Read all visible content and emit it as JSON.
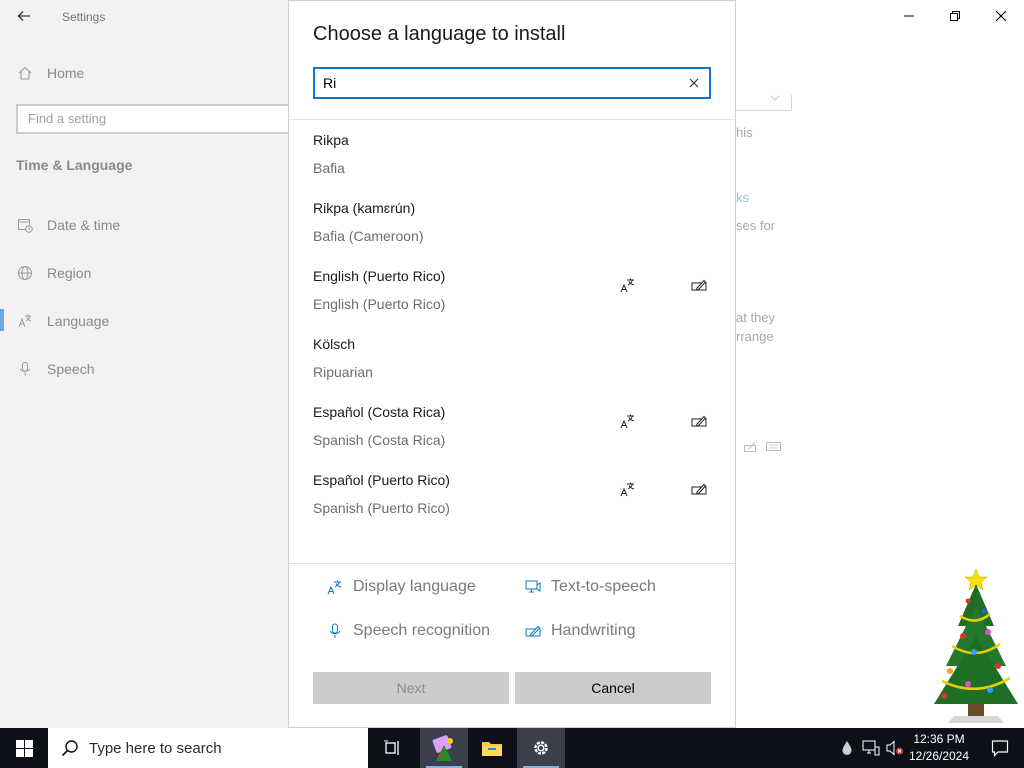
{
  "window": {
    "title": "Settings",
    "controls": {
      "minimize": "minimize-icon",
      "maximize": "restore-icon",
      "close": "close-icon"
    }
  },
  "nav": {
    "home": "Home",
    "find_placeholder": "Find a setting",
    "section": "Time & Language",
    "items": [
      {
        "label": "Date & time",
        "icon": "calendar-clock-icon"
      },
      {
        "label": "Region",
        "icon": "globe-icon"
      },
      {
        "label": "Language",
        "icon": "language-icon",
        "selected": true
      },
      {
        "label": "Speech",
        "icon": "microphone-icon"
      }
    ]
  },
  "background_peek": [
    "his",
    "ks",
    "ses for",
    "at they",
    "rrange"
  ],
  "dialog": {
    "title": "Choose a language to install",
    "search_value": "Ri",
    "languages": [
      {
        "native": "Rikpa",
        "english": "Bafia",
        "display_language": false,
        "handwriting": false
      },
      {
        "native": "Rikpa (kamɛrún)",
        "english": "Bafia (Cameroon)",
        "display_language": false,
        "handwriting": false
      },
      {
        "native": "English (Puerto Rico)",
        "english": "English (Puerto Rico)",
        "display_language": true,
        "handwriting": true
      },
      {
        "native": "Kölsch",
        "english": "Ripuarian",
        "display_language": false,
        "handwriting": false
      },
      {
        "native": "Español (Costa Rica)",
        "english": "Spanish (Costa Rica)",
        "display_language": true,
        "handwriting": true
      },
      {
        "native": "Español (Puerto Rico)",
        "english": "Spanish (Puerto Rico)",
        "display_language": true,
        "handwriting": true
      }
    ],
    "features": {
      "display_language": "Display language",
      "text_to_speech": "Text-to-speech",
      "speech_recognition": "Speech recognition",
      "handwriting": "Handwriting"
    },
    "buttons": {
      "next": "Next",
      "cancel": "Cancel"
    }
  },
  "taskbar": {
    "search_placeholder": "Type here to search",
    "time": "12:36 PM",
    "date": "12/26/2024"
  },
  "colors": {
    "accent": "#0d78c4",
    "taskbar": "#0d1018",
    "nav_bg": "#f2f2f2",
    "button_bg": "#cccccc"
  }
}
